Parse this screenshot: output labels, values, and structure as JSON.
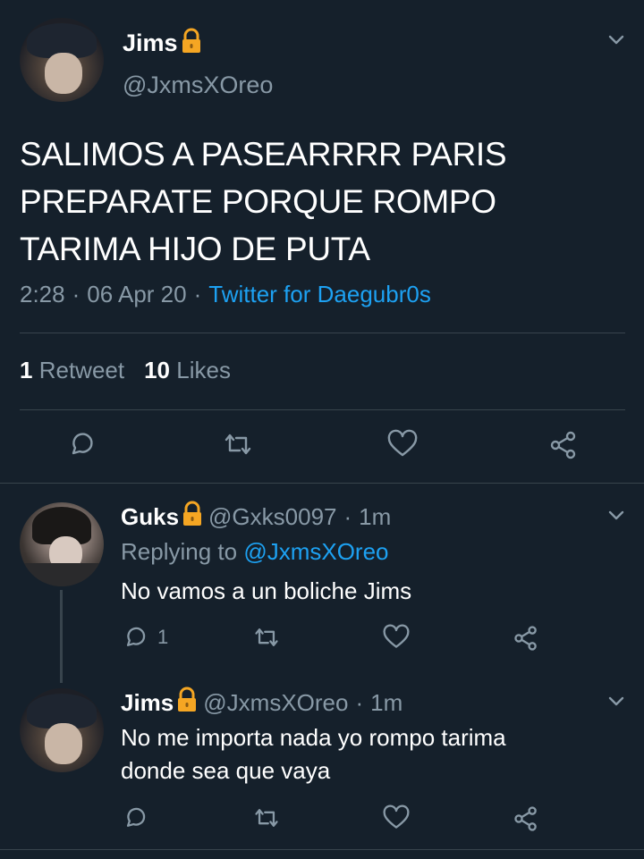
{
  "main_tweet": {
    "display_name": "Jims",
    "handle": "@JxmsXOreo",
    "text_lines": [
      "SALIMOS A PASEARRRR PARIS",
      "PREPARATE PORQUE ROMPO",
      "TARIMA HIJO DE PUTA"
    ],
    "time": "2:28",
    "date": "06 Apr 20",
    "source": "Twitter for Daegubr0s",
    "retweets_count": "1",
    "retweets_label": "Retweet",
    "likes_count": "10",
    "likes_label": "Likes",
    "lock_icon": "lock-icon",
    "more_icon": "chevron-down-icon"
  },
  "replies": [
    {
      "display_name": "Guks",
      "handle": "@Gxks0097",
      "time": "1m",
      "replying_to_label": "Replying to",
      "replying_to_handle": "@JxmsXOreo",
      "text_lines": [
        "No vamos a un boliche Jims"
      ],
      "reply_count": "1"
    },
    {
      "display_name": "Jims",
      "handle": "@JxmsXOreo",
      "time": "1m",
      "text_lines": [
        "No me importa nada yo rompo tarima",
        "donde sea que vaya"
      ],
      "reply_count": ""
    }
  ],
  "separator": "·",
  "colors": {
    "background": "#15202b",
    "muted": "#8899a6",
    "link": "#1da1f2",
    "lock": "#f5a623",
    "divider": "#38444d"
  }
}
